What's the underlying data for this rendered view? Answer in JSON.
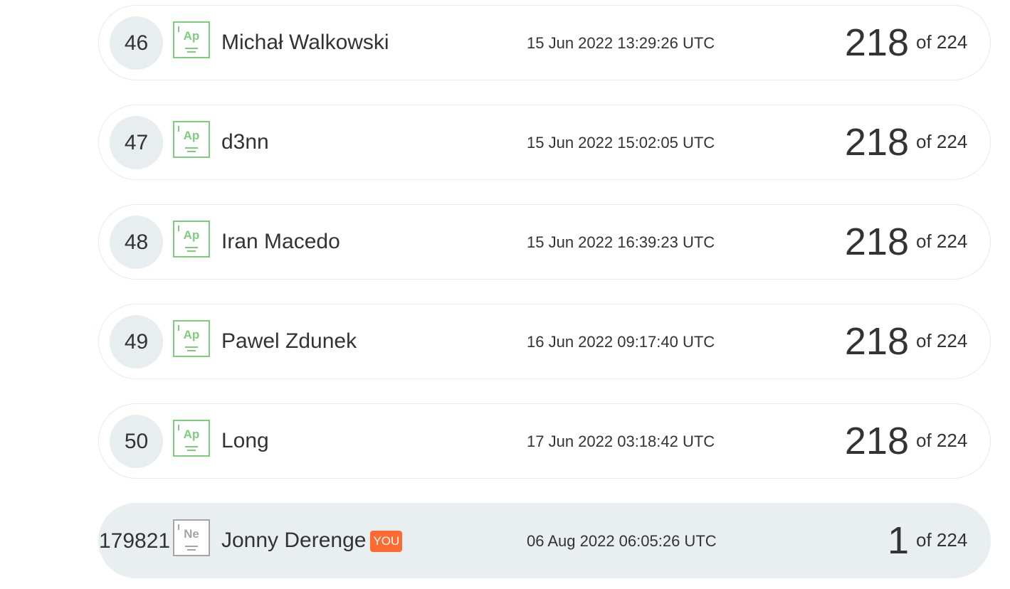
{
  "leaderboard": {
    "rows": [
      {
        "rank": "46",
        "badge": "Ap",
        "name": "Michał Walkowski",
        "date": "15 Jun 2022 13:29:26 UTC",
        "score": "218",
        "total": "of 224"
      },
      {
        "rank": "47",
        "badge": "Ap",
        "name": "d3nn",
        "date": "15 Jun 2022 15:02:05 UTC",
        "score": "218",
        "total": "of 224"
      },
      {
        "rank": "48",
        "badge": "Ap",
        "name": "Iran Macedo",
        "date": "15 Jun 2022 16:39:23 UTC",
        "score": "218",
        "total": "of 224"
      },
      {
        "rank": "49",
        "badge": "Ap",
        "name": "Pawel Zdunek",
        "date": "16 Jun 2022 09:17:40 UTC",
        "score": "218",
        "total": "of 224"
      },
      {
        "rank": "50",
        "badge": "Ap",
        "name": "Long",
        "date": "17 Jun 2022 03:18:42 UTC",
        "score": "218",
        "total": "of 224"
      }
    ],
    "current_user": {
      "rank": "179821",
      "badge": "Ne",
      "name": "Jonny Derenge",
      "you_label": "YOU",
      "date": "06 Aug 2022 06:05:26 UTC",
      "score": "1",
      "total": "of 224"
    }
  },
  "colors": {
    "badge_green": "#7cce7a",
    "badge_grey": "#a5a5a5",
    "you_tag": "#ff6a33",
    "current_row_bg": "#e9eef1"
  }
}
